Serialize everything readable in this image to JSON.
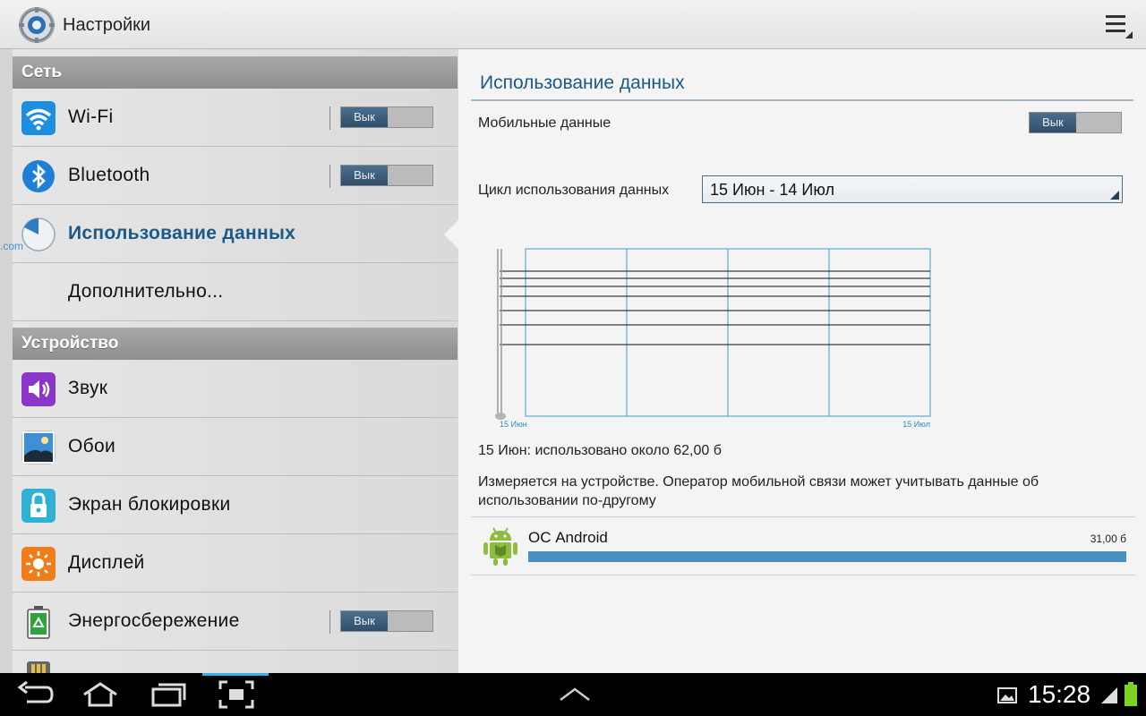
{
  "app": {
    "title": "Настройки"
  },
  "sidebar": {
    "sections": [
      {
        "header": "Сеть"
      },
      {
        "header": "Устройство"
      }
    ],
    "items": [
      {
        "label": "Wi-Fi",
        "toggle": "Вык"
      },
      {
        "label": "Bluetooth",
        "toggle": "Вык"
      },
      {
        "label": "Использование данных"
      },
      {
        "label": "Дополнительно..."
      },
      {
        "label": "Звук"
      },
      {
        "label": "Обои"
      },
      {
        "label": "Экран блокировки"
      },
      {
        "label": "Дисплей"
      },
      {
        "label": "Энергосбережение",
        "toggle": "Вык"
      }
    ],
    "side_fragment": ".com"
  },
  "main": {
    "title": "Использование данных",
    "mobile_data": {
      "label": "Мобильные данные",
      "toggle": "Вык"
    },
    "cycle": {
      "label": "Цикл использования данных",
      "value": "15 Июн - 14 Июл"
    },
    "chart_data": {
      "type": "line",
      "x_start_label": "15 Июн",
      "x_end_label": "15 Июл"
    },
    "usage_summary": "15 Июн: использовано около 62,00 б",
    "note": "Измеряется на устройстве. Оператор мобильной связи может учитывать данные об использовании по-другому",
    "apps": [
      {
        "name": "ОС Android",
        "size": "31,00 б",
        "share": 1.0
      }
    ]
  },
  "statusbar": {
    "time": "15:28"
  },
  "colors": {
    "accent": "#1b5a86",
    "toggle_on": "#2f4e6a",
    "bar": "#4a8fc2",
    "chart_grid": "#3aa0c8"
  }
}
